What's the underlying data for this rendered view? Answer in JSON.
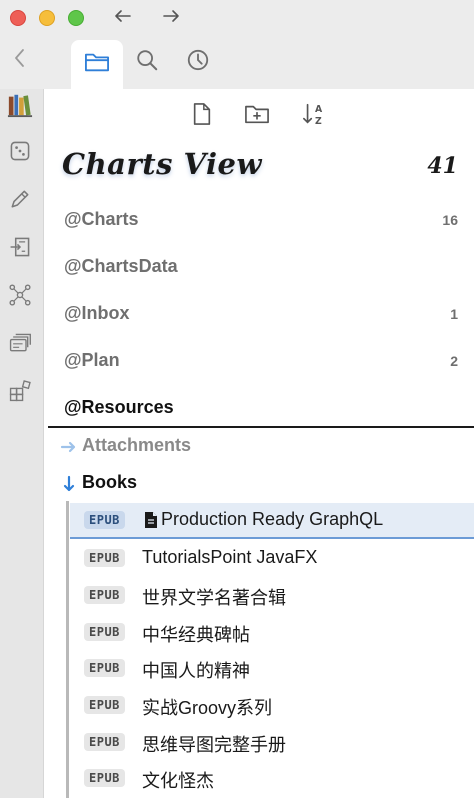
{
  "window": {
    "icons": {
      "back": "arrow-left-icon",
      "forward": "arrow-right-icon"
    }
  },
  "tabs": [
    {
      "icon": "folder-icon",
      "active": true
    },
    {
      "icon": "search-icon",
      "active": false
    },
    {
      "icon": "clock-icon",
      "active": false
    }
  ],
  "rail": {
    "items": [
      "books-icon",
      "dice-icon",
      "pencil-icon",
      "document-import-icon",
      "graph-icon",
      "cards-icon",
      "grid-icon"
    ]
  },
  "toolbar": {
    "icons": [
      "new-document-icon",
      "new-folder-icon",
      "sort-az-icon"
    ]
  },
  "notebook": {
    "title": "Charts View",
    "count": "41"
  },
  "stacks": [
    {
      "label": "@Charts",
      "count": "16"
    },
    {
      "label": "@ChartsData",
      "count": ""
    },
    {
      "label": "@Inbox",
      "count": "1"
    },
    {
      "label": "@Plan",
      "count": "2"
    },
    {
      "label": "@Resources",
      "count": ""
    }
  ],
  "folders": [
    {
      "label": "Attachments",
      "state": "collapsed"
    },
    {
      "label": "Books",
      "state": "expanded"
    }
  ],
  "files": [
    {
      "badge": "EPUB",
      "title": "Production Ready GraphQL",
      "selected": true
    },
    {
      "badge": "EPUB",
      "title": "TutorialsPoint JavaFX"
    },
    {
      "badge": "EPUB",
      "title": "世界文学名著合辑"
    },
    {
      "badge": "EPUB",
      "title": "中华经典碑帖"
    },
    {
      "badge": "EPUB",
      "title": "中国人的精神"
    },
    {
      "badge": "EPUB",
      "title": "实战Groovy系列"
    },
    {
      "badge": "EPUB",
      "title": "思维导图完整手册"
    },
    {
      "badge": "EPUB",
      "title": "文化怪杰"
    }
  ],
  "colors": {
    "accent": "#2f7fd8",
    "selection": "#e4ecf6",
    "collapsed_arrow": "#9ec2ea"
  }
}
